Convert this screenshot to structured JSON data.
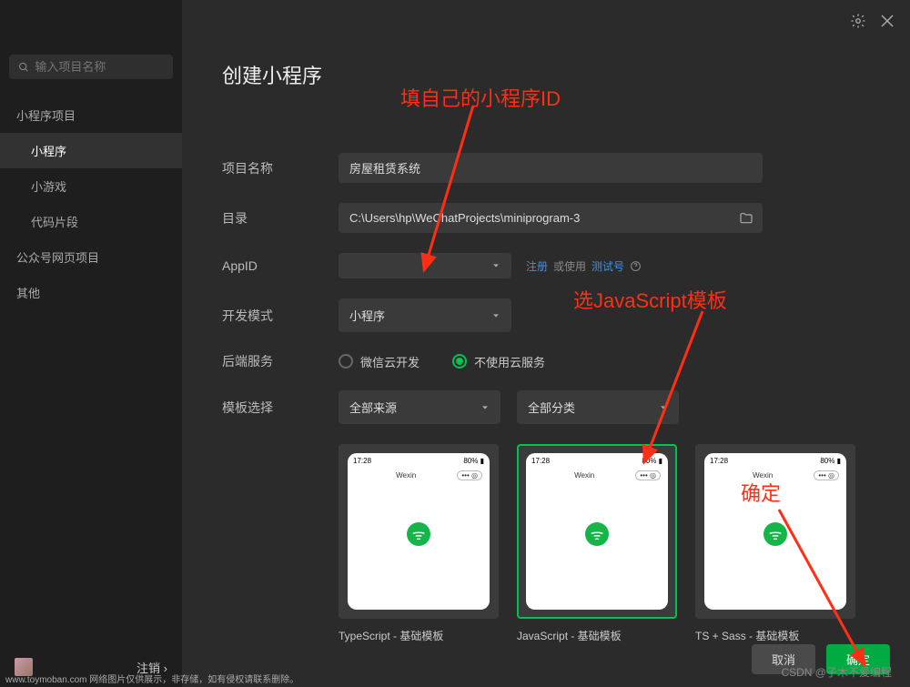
{
  "search": {
    "placeholder": "输入项目名称"
  },
  "sidebar": {
    "section1": "小程序项目",
    "items": [
      "小程序",
      "小游戏",
      "代码片段"
    ],
    "section2": "公众号网页项目",
    "section3": "其他",
    "active_index": 0,
    "logout": "注销 ›"
  },
  "titlebar": {
    "settings": "settings",
    "close": "close"
  },
  "page": {
    "title": "创建小程序"
  },
  "form": {
    "project_name_label": "项目名称",
    "project_name_value": "房屋租赁系统",
    "directory_label": "目录",
    "directory_value": "C:\\Users\\hp\\WeChatProjects\\miniprogram-3",
    "appid_label": "AppID",
    "appid_value": "",
    "appid_register": "注册",
    "appid_or": " 或使用 ",
    "appid_test": "测试号",
    "dev_mode_label": "开发模式",
    "dev_mode_value": "小程序",
    "backend_label": "后端服务",
    "backend_cloud": "微信云开发",
    "backend_none": "不使用云服务",
    "template_label": "模板选择",
    "template_source": "全部来源",
    "template_category": "全部分类"
  },
  "templates": {
    "phone_time": "17:28",
    "phone_title": "Wexin",
    "list": [
      {
        "name": "TypeScript - 基础模板"
      },
      {
        "name": "JavaScript - 基础模板"
      },
      {
        "name": "TS + Sass - 基础模板"
      }
    ],
    "selected_index": 1
  },
  "actions": {
    "cancel": "取消",
    "confirm": "确定"
  },
  "annotations": {
    "a1": "填自己的小程序ID",
    "a2": "选JavaScript模板",
    "a3": "确定"
  },
  "watermark": "CSDN @子木不爱编程",
  "watermark_left": "www.toymoban.com 网络图片仅供展示，非存储，如有侵权请联系删除。"
}
